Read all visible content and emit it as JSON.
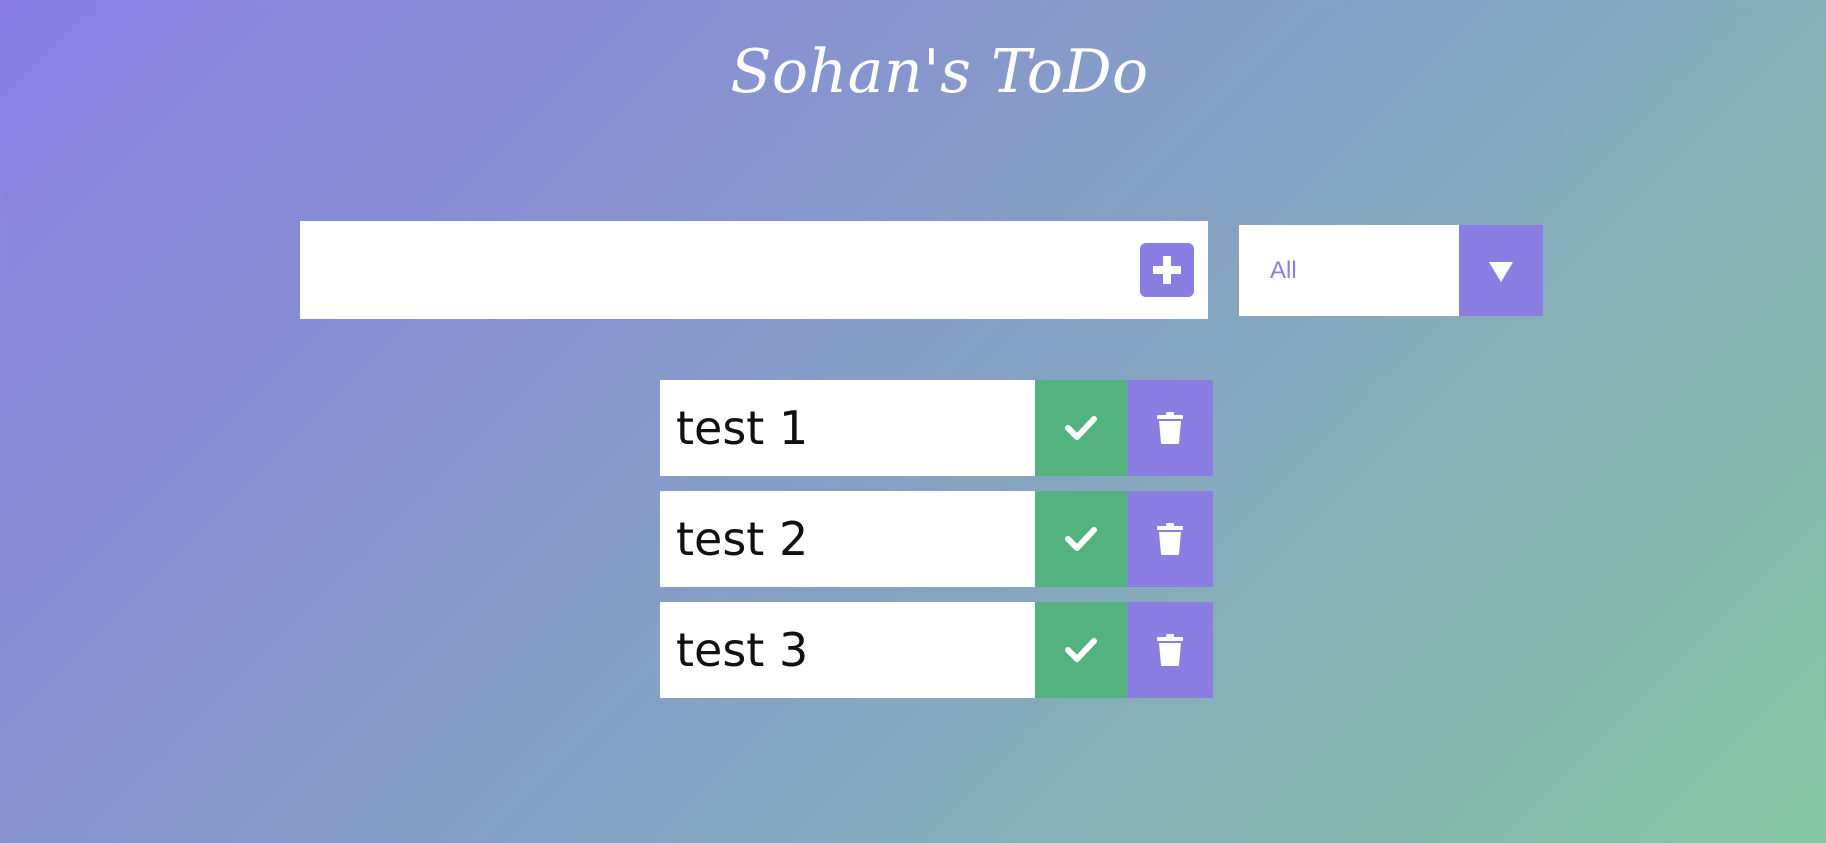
{
  "app": {
    "title": "Sohan's ToDo"
  },
  "input": {
    "value": "",
    "placeholder": ""
  },
  "add_button": {
    "icon": "plus-icon"
  },
  "filter": {
    "selected": "All",
    "icon": "triangle-down-icon"
  },
  "todos": [
    {
      "text": "test 1",
      "complete_icon": "check-icon",
      "delete_icon": "trash-icon"
    },
    {
      "text": "test 2",
      "complete_icon": "check-icon",
      "delete_icon": "trash-icon"
    },
    {
      "text": "test 3",
      "complete_icon": "check-icon",
      "delete_icon": "trash-icon"
    }
  ],
  "colors": {
    "accent": "#8a7ee3",
    "complete": "#53b37f",
    "text": "#111111",
    "background_start": "#8a7ee3",
    "background_end": "#85c7a4"
  }
}
